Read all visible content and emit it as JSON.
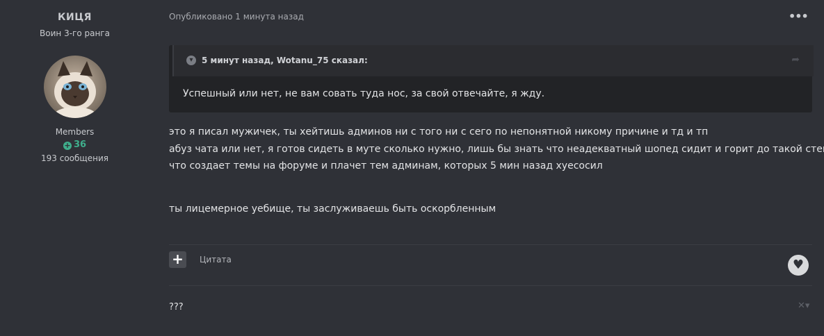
{
  "author": {
    "name": "КИЦЯ",
    "rank": "Воин 3-го ранга",
    "group": "Members",
    "reputation": "36",
    "posts": "193 сообщения"
  },
  "post": {
    "meta": "Опубликовано 1 минута назад",
    "quote": {
      "header": "5 минут назад, Wotanu_75 сказал:",
      "text": "Успешный или нет, не вам совать туда нос, за свой отвечайте, я жду."
    },
    "lines": [
      "это я писал мужичек, ты хейтишь админов ни с того ни с сего по непонятной никому причине и тд и тп",
      "абуз чата или нет, я готов сидеть в муте сколько нужно, лишь бы знать что неадекватный шопед сидит и горит до такой степени",
      "что создает темы на форуме и плачет тем админам, которых 5 мин назад хуесосил",
      "ты лицемерное уебище, ты заслуживаешь быть оскорбленным"
    ]
  },
  "actions": {
    "plus_label": "+",
    "quote_label": "Цитата"
  },
  "comment": {
    "text": "???"
  },
  "icons": {
    "more": "ellipsis-icon",
    "quote_toggle": "chevron-down-icon",
    "share": "share-icon",
    "like": "heart-icon",
    "close": "close-icon"
  },
  "colors": {
    "background": "#2f3137",
    "quote_background": "#222326",
    "reputation": "#3fae8c"
  }
}
